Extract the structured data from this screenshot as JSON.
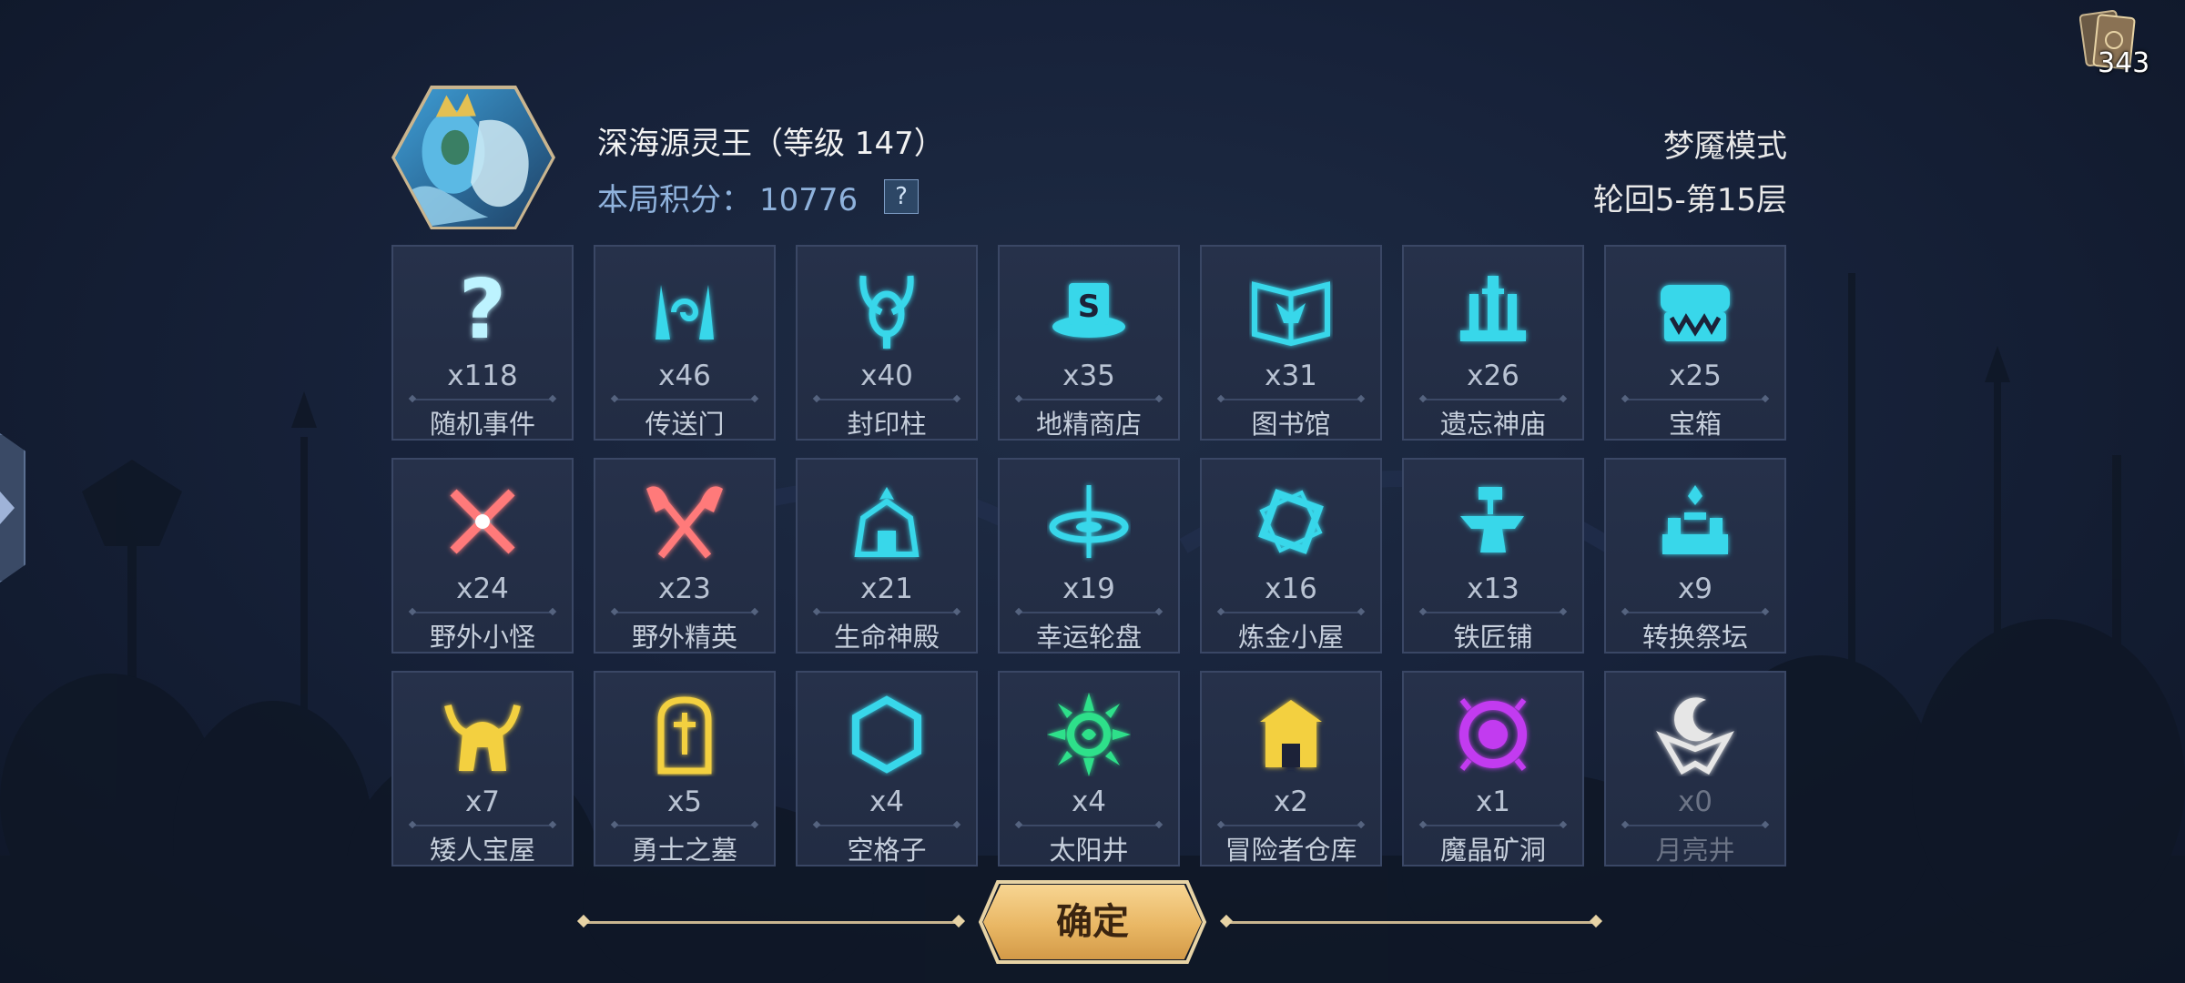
{
  "player": {
    "boss_name": "深海源灵王（等级 147）",
    "score_label": "本局积分：",
    "score_value": "10776",
    "help_label": "?"
  },
  "mode": {
    "name": "梦魇模式",
    "floor": "轮回5-第15层"
  },
  "deck": {
    "count": "343"
  },
  "tiles": [
    {
      "count": "x118",
      "name": "随机事件",
      "icon": "question-icon",
      "color": "#bdf3ff"
    },
    {
      "count": "x46",
      "name": "传送门",
      "icon": "portal-icon",
      "color": "#37d7ea"
    },
    {
      "count": "x40",
      "name": "封印柱",
      "icon": "seal-pillar-icon",
      "color": "#37d7ea"
    },
    {
      "count": "x35",
      "name": "地精商店",
      "icon": "goblin-shop-icon",
      "color": "#37d7ea"
    },
    {
      "count": "x31",
      "name": "图书馆",
      "icon": "library-book-icon",
      "color": "#37d7ea"
    },
    {
      "count": "x26",
      "name": "遗忘神庙",
      "icon": "temple-icon",
      "color": "#37d7ea"
    },
    {
      "count": "x25",
      "name": "宝箱",
      "icon": "chest-icon",
      "color": "#37d7ea"
    },
    {
      "count": "x24",
      "name": "野外小怪",
      "icon": "crossed-swords-icon",
      "color": "#ff7a7a"
    },
    {
      "count": "x23",
      "name": "野外精英",
      "icon": "crossed-axes-icon",
      "color": "#ff7a7a"
    },
    {
      "count": "x21",
      "name": "生命神殿",
      "icon": "life-shrine-icon",
      "color": "#37d7ea"
    },
    {
      "count": "x19",
      "name": "幸运轮盘",
      "icon": "wheel-icon",
      "color": "#37d7ea"
    },
    {
      "count": "x16",
      "name": "炼金小屋",
      "icon": "alchemy-icon",
      "color": "#37d7ea"
    },
    {
      "count": "x13",
      "name": "铁匠铺",
      "icon": "anvil-icon",
      "color": "#37d7ea"
    },
    {
      "count": "x9",
      "name": "转换祭坛",
      "icon": "altar-icon",
      "color": "#37d7ea"
    },
    {
      "count": "x7",
      "name": "矮人宝屋",
      "icon": "viking-helmet-icon",
      "color": "#f3d03f"
    },
    {
      "count": "x5",
      "name": "勇士之墓",
      "icon": "tomb-icon",
      "color": "#f3d03f"
    },
    {
      "count": "x4",
      "name": "空格子",
      "icon": "hexagon-icon",
      "color": "#37d7ea"
    },
    {
      "count": "x4",
      "name": "太阳井",
      "icon": "sun-well-icon",
      "color": "#2ee08a"
    },
    {
      "count": "x2",
      "name": "冒险者仓库",
      "icon": "warehouse-icon",
      "color": "#f3d03f"
    },
    {
      "count": "x1",
      "name": "魔晶矿洞",
      "icon": "crystal-mine-icon",
      "color": "#c23bf0"
    },
    {
      "count": "x0",
      "name": "月亮井",
      "icon": "moon-well-icon",
      "color": "#e6e6e6"
    }
  ],
  "confirm_label": "确定",
  "colors": {
    "accent_cyan": "#37d7ea",
    "button_gold": "#e9b764",
    "panel_bg": "#222c43"
  }
}
